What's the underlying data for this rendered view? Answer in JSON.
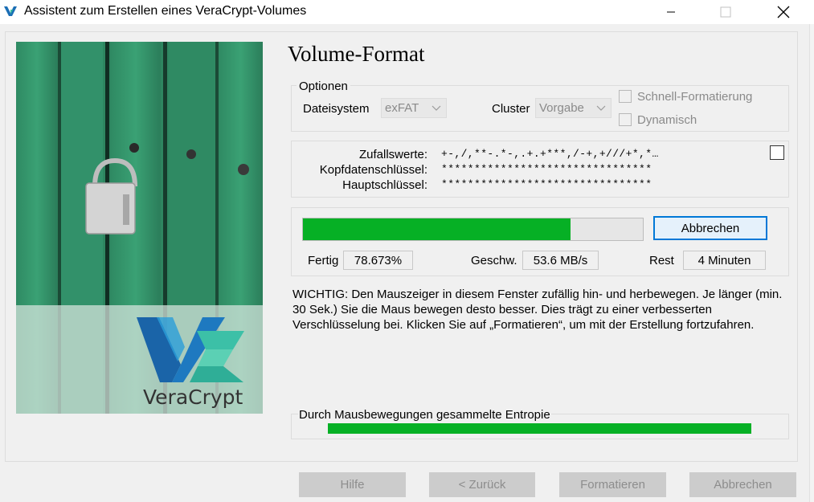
{
  "window": {
    "title": "Assistent zum Erstellen eines VeraCrypt-Volumes"
  },
  "page": {
    "title": "Volume-Format"
  },
  "options": {
    "legend": "Optionen",
    "filesystem_label": "Dateisystem",
    "filesystem_value": "exFAT",
    "cluster_label": "Cluster",
    "cluster_value": "Vorgabe",
    "quick_format_label": "Schnell-Formatierung",
    "quick_format_checked": false,
    "dynamic_label": "Dynamisch",
    "dynamic_checked": false
  },
  "keys": {
    "random_label": "Zufallswerte:",
    "random_value": "+-,/,**-.*-,.+.+***,/-+,+///+*,*…",
    "header_key_label": "Kopfdatenschlüssel:",
    "header_key_value": "********************************",
    "master_key_label": "Hauptschlüssel:",
    "master_key_value": "********************************",
    "show_checked": false
  },
  "progress": {
    "fraction": 0.78673,
    "abort_label": "Abbrechen",
    "done_label": "Fertig",
    "done_value": "78.673%",
    "speed_label": "Geschw.",
    "speed_value": "53.6 MB/s",
    "remaining_label": "Rest",
    "remaining_value": "4 Minuten"
  },
  "info": {
    "text": "WICHTIG: Den Mauszeiger in diesem Fenster zufällig hin- und herbewegen. Je länger (min. 30 Sek.) Sie die Maus bewegen desto besser. Dies trägt zu einer verbesserten Verschlüsselung bei. Klicken Sie auf „Formatieren“, um mit der Erstellung fortzufahren."
  },
  "entropy": {
    "label": "Durch Mausbewegungen gesammelte Entropie",
    "fraction": 1.0
  },
  "buttons": {
    "help": "Hilfe",
    "back": "< Zurück",
    "format": "Formatieren",
    "cancel": "Abbrechen"
  },
  "logo": {
    "text": "VeraCrypt"
  },
  "colors": {
    "progress_green": "#06b025",
    "accent_blue": "#0078d7"
  }
}
